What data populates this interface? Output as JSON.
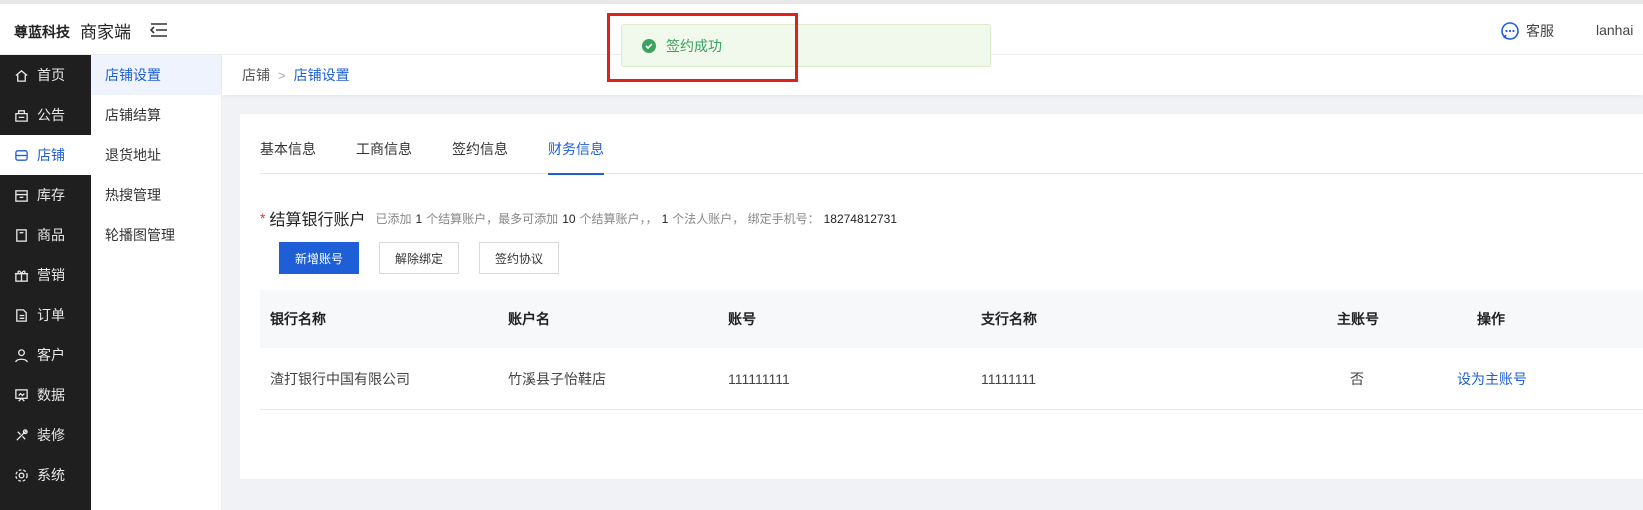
{
  "header": {
    "brand": "尊蓝科技",
    "portal": "商家端",
    "customer_service": "客服",
    "user": "lanhai"
  },
  "sidebar": {
    "items": [
      {
        "label": "首页",
        "icon": "home-icon"
      },
      {
        "label": "公告",
        "icon": "notice-icon"
      },
      {
        "label": "店铺",
        "icon": "store-icon"
      },
      {
        "label": "库存",
        "icon": "inventory-icon"
      },
      {
        "label": "商品",
        "icon": "goods-icon"
      },
      {
        "label": "营销",
        "icon": "gift-icon"
      },
      {
        "label": "订单",
        "icon": "order-icon"
      },
      {
        "label": "客户",
        "icon": "user-icon"
      },
      {
        "label": "数据",
        "icon": "data-icon"
      },
      {
        "label": "装修",
        "icon": "decor-icon"
      },
      {
        "label": "系统",
        "icon": "gear-icon"
      }
    ],
    "active": "店铺"
  },
  "submenu": {
    "items": [
      "店铺设置",
      "店铺结算",
      "退货地址",
      "热搜管理",
      "轮播图管理"
    ],
    "active": "店铺设置"
  },
  "breadcrumb": {
    "root": "店铺",
    "current": "店铺设置"
  },
  "tabs": {
    "items": [
      "基本信息",
      "工商信息",
      "签约信息",
      "财务信息"
    ],
    "active": "财务信息"
  },
  "section": {
    "required_mark": "*",
    "title": "结算银行账户",
    "note_part1": "已添加",
    "added_count": "1",
    "note_part2": "个结算账户，最多可添加",
    "max_count": "10",
    "note_part3": "个结算账户，，",
    "legal_count": "1",
    "note_part4": "个法人账户，  绑定手机号：",
    "phone": "18274812731"
  },
  "buttons": {
    "add": "新增账号",
    "unbind": "解除绑定",
    "agreement": "签约协议"
  },
  "table": {
    "headers": [
      "银行名称",
      "账户名",
      "账号",
      "支行名称",
      "主账号",
      "操作"
    ],
    "rows": [
      {
        "bank": "渣打银行中国有限公司",
        "account_name": "竹溪县子怡鞋店",
        "account_no": "111111111",
        "branch": "11111111",
        "is_main": "否",
        "action": "设为主账号"
      }
    ]
  },
  "toast": {
    "message": "签约成功"
  },
  "colors": {
    "primary": "#1e5fd7",
    "success": "#3aa35f",
    "highlight": "#e02020",
    "sidebar_bg": "#1f1f1f"
  }
}
